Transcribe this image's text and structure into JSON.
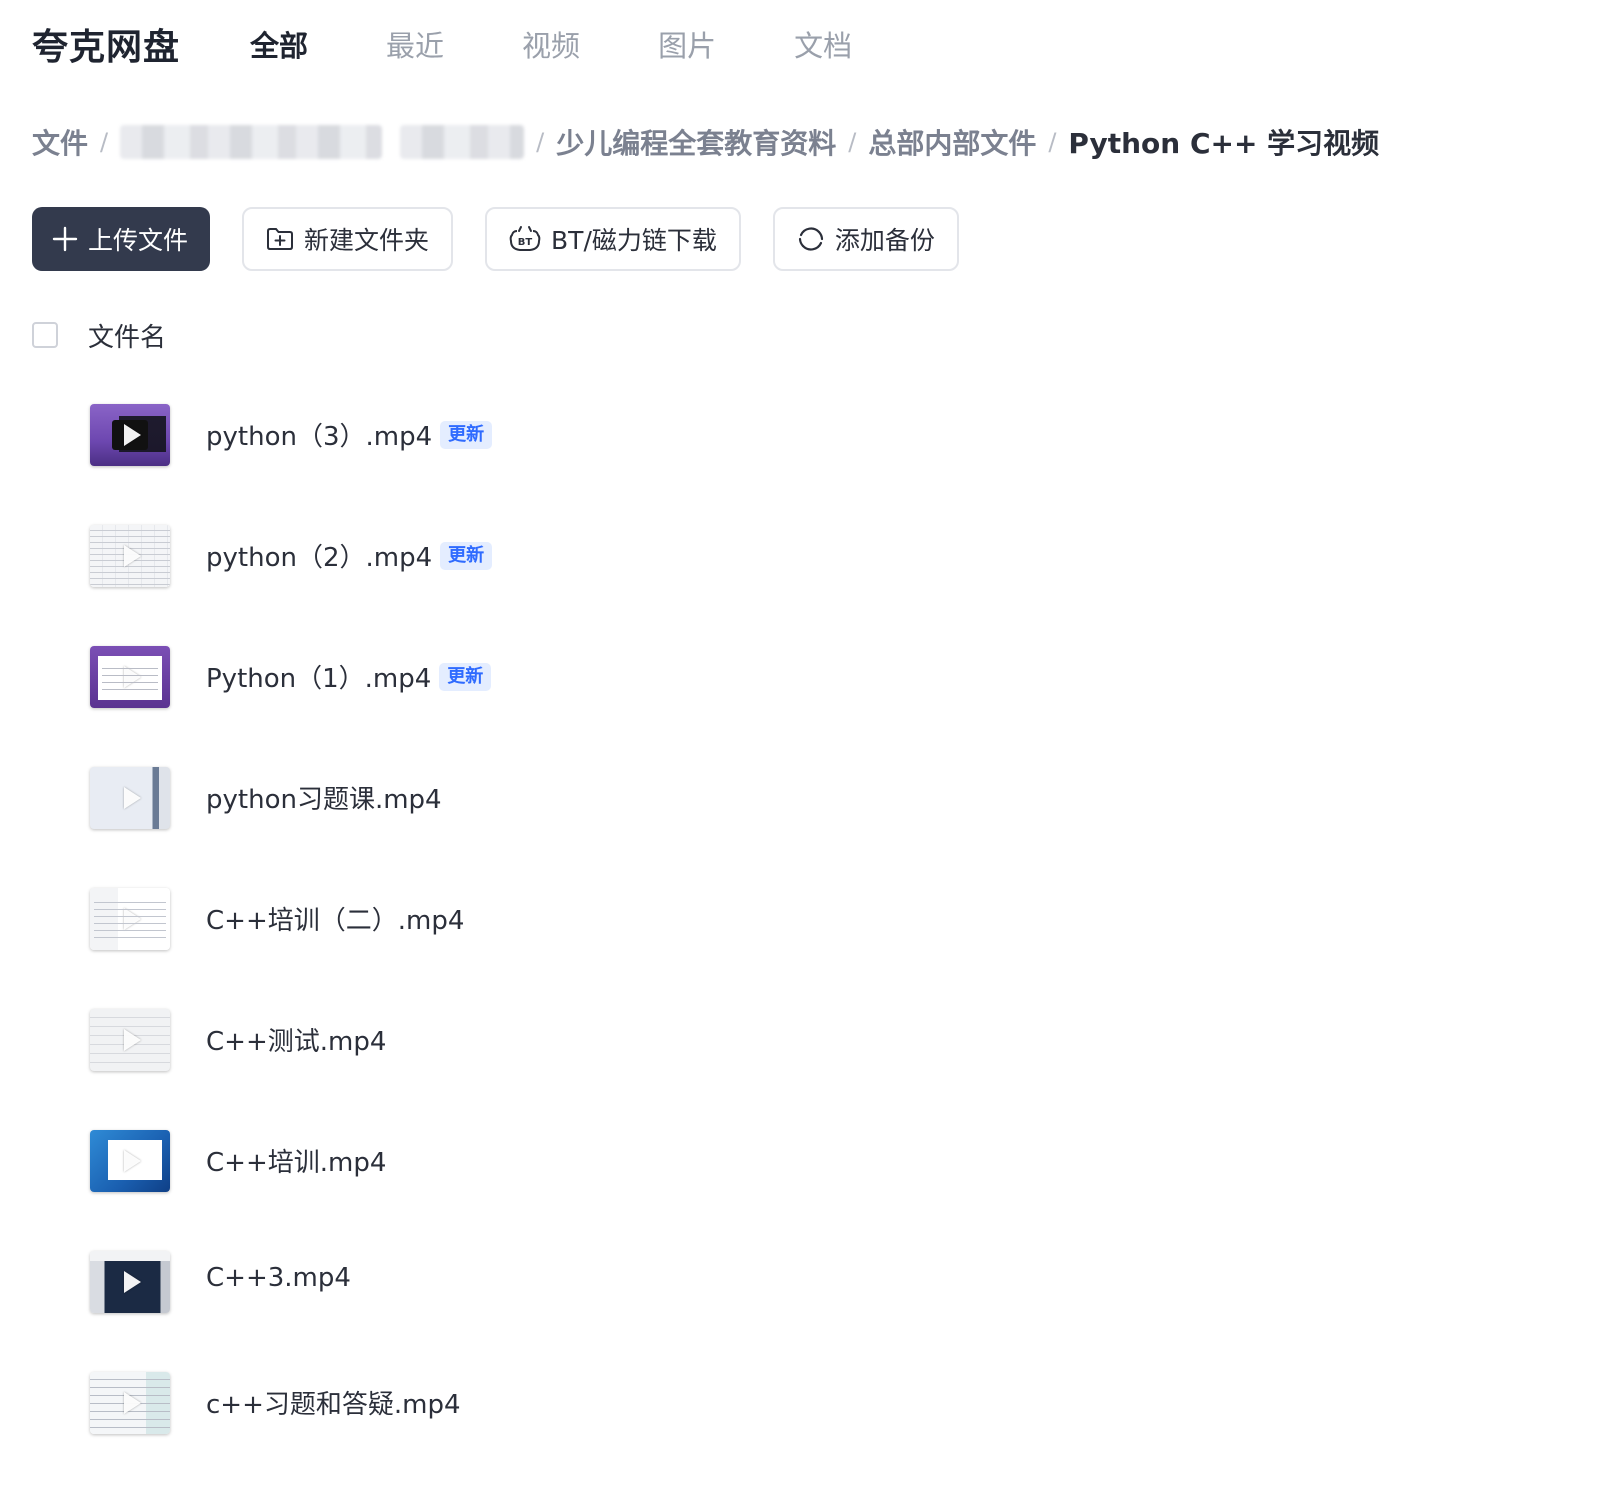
{
  "app": {
    "logo": "夸克网盘"
  },
  "nav": {
    "tabs": [
      {
        "label": "全部",
        "active": true
      },
      {
        "label": "最近",
        "active": false
      },
      {
        "label": "视频",
        "active": false
      },
      {
        "label": "图片",
        "active": false
      },
      {
        "label": "文档",
        "active": false
      }
    ]
  },
  "breadcrumb": {
    "root": "文件",
    "separator": "/",
    "items": [
      "少儿编程全套教育资料",
      "总部内部文件"
    ],
    "current": "Python C++ 学习视频"
  },
  "toolbar": {
    "upload_label": "上传文件",
    "new_folder_label": "新建文件夹",
    "bt_download_label": "BT/磁力链下载",
    "add_backup_label": "添加备份"
  },
  "list": {
    "column_name": "文件名",
    "badge_update": "更新",
    "files": [
      {
        "name": "python（3）.mp4",
        "updated": true
      },
      {
        "name": "python（2）.mp4",
        "updated": true
      },
      {
        "name": "Python（1）.mp4",
        "updated": true
      },
      {
        "name": "python习题课.mp4",
        "updated": false
      },
      {
        "name": "C++培训（二）.mp4",
        "updated": false
      },
      {
        "name": "C++测试.mp4",
        "updated": false
      },
      {
        "name": "C++培训.mp4",
        "updated": false
      },
      {
        "name": "C++3.mp4",
        "updated": false
      },
      {
        "name": "c++习题和答疑.mp4",
        "updated": false
      }
    ]
  },
  "colors": {
    "primary_button": "#333a4d",
    "badge_bg": "#e4edff",
    "badge_text": "#2f6bff",
    "text_main": "#2b2f3a",
    "text_muted": "#9aa0ab"
  }
}
